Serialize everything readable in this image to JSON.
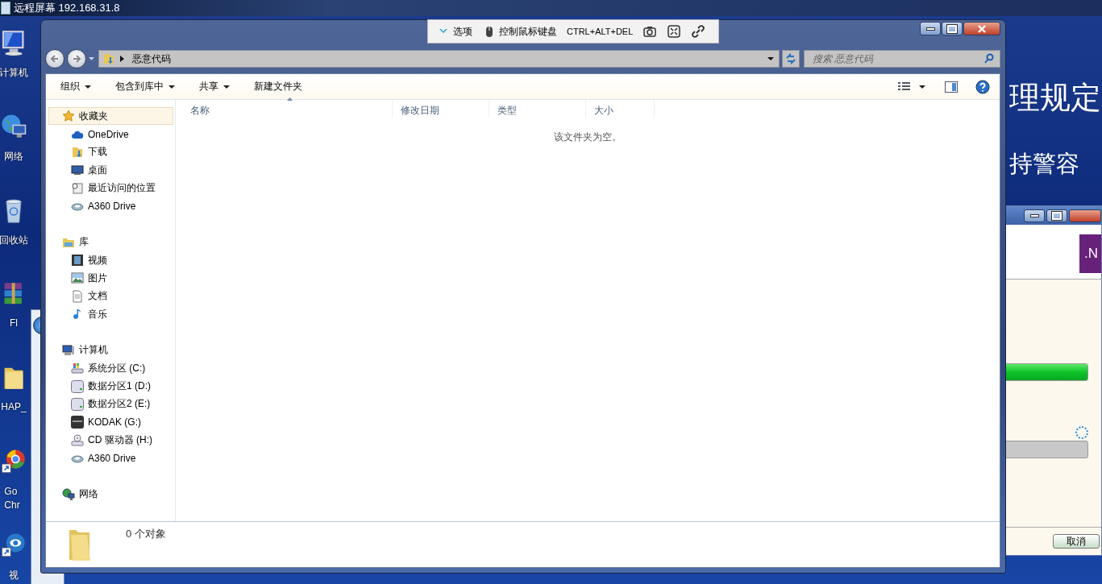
{
  "remote_viewer": {
    "title": "远程屏幕 192.168.31.8"
  },
  "remote_toolbar": [
    {
      "kind": "chevron",
      "label": "选项"
    },
    {
      "kind": "mouse",
      "label": "控制鼠标键盘"
    },
    {
      "kind": "text",
      "label": "CTRL+ALT+DEL"
    },
    {
      "kind": "camera"
    },
    {
      "kind": "fullscreen"
    },
    {
      "kind": "link"
    }
  ],
  "desktop": {
    "icons": [
      {
        "kind": "computer",
        "label": "计算机"
      },
      {
        "kind": "network",
        "label": "网络"
      },
      {
        "kind": "recycle",
        "label": "回收站"
      },
      {
        "kind": "archive",
        "label": "Fl"
      },
      {
        "kind": "folder",
        "label": "HAP_"
      },
      {
        "kind": "browser",
        "label": "Go",
        "label_2": "Chr"
      },
      {
        "kind": "player",
        "label": "视"
      }
    ],
    "banner": [
      "理规定",
      "持警容"
    ]
  },
  "explorer": {
    "address": {
      "path": "恶意代码"
    },
    "search": {
      "placeholder": "搜索 恶意代码"
    },
    "toolbar": [
      {
        "label": "组织",
        "menu": true
      },
      {
        "label": "包含到库中",
        "menu": true
      },
      {
        "label": "共享",
        "menu": true
      },
      {
        "label": "新建文件夹",
        "menu": false
      }
    ],
    "sidebar": [
      {
        "kind": "star",
        "label": "收藏夹",
        "selected": true,
        "children": [
          {
            "kind": "cloud",
            "label": "OneDrive",
            "selected": false
          },
          {
            "kind": "download",
            "label": "下载",
            "selected": false
          },
          {
            "kind": "desktop",
            "label": "桌面",
            "selected": false
          },
          {
            "kind": "recent",
            "label": "最近访问的位置",
            "selected": false
          },
          {
            "kind": "a360",
            "label": "A360 Drive",
            "selected": false
          }
        ]
      },
      {
        "kind": "library",
        "label": "库",
        "selected": false,
        "children": [
          {
            "kind": "video",
            "label": "视频",
            "selected": false
          },
          {
            "kind": "picture",
            "label": "图片",
            "selected": false
          },
          {
            "kind": "document",
            "label": "文档",
            "selected": false
          },
          {
            "kind": "music",
            "label": "音乐",
            "selected": false
          }
        ]
      },
      {
        "kind": "computer",
        "label": "计算机",
        "selected": false,
        "children": [
          {
            "kind": "windrive",
            "label": "系统分区 (C:)",
            "selected": false
          },
          {
            "kind": "drive",
            "label": "数据分区1 (D:)",
            "selected": false
          },
          {
            "kind": "drive",
            "label": "数据分区2 (E:)",
            "selected": false
          },
          {
            "kind": "usb",
            "label": "KODAK (G:)",
            "selected": false
          },
          {
            "kind": "cd",
            "label": "CD 驱动器 (H:)",
            "selected": false
          },
          {
            "kind": "a360",
            "label": "A360 Drive",
            "selected": false
          }
        ]
      },
      {
        "kind": "network",
        "label": "网络",
        "selected": false
      }
    ],
    "columns": [
      {
        "label": "名称",
        "sorted": true
      },
      {
        "label": "修改日期",
        "sorted": false
      },
      {
        "label": "类型",
        "sorted": false
      },
      {
        "label": "大小",
        "sorted": false
      }
    ],
    "empty_message": "该文件夹为空。",
    "status": "0 个对象"
  },
  "background_window": {
    "logo": ".N",
    "progress": [
      {
        "level": 1
      },
      {
        "level": 0
      }
    ],
    "cancel": "取消"
  }
}
